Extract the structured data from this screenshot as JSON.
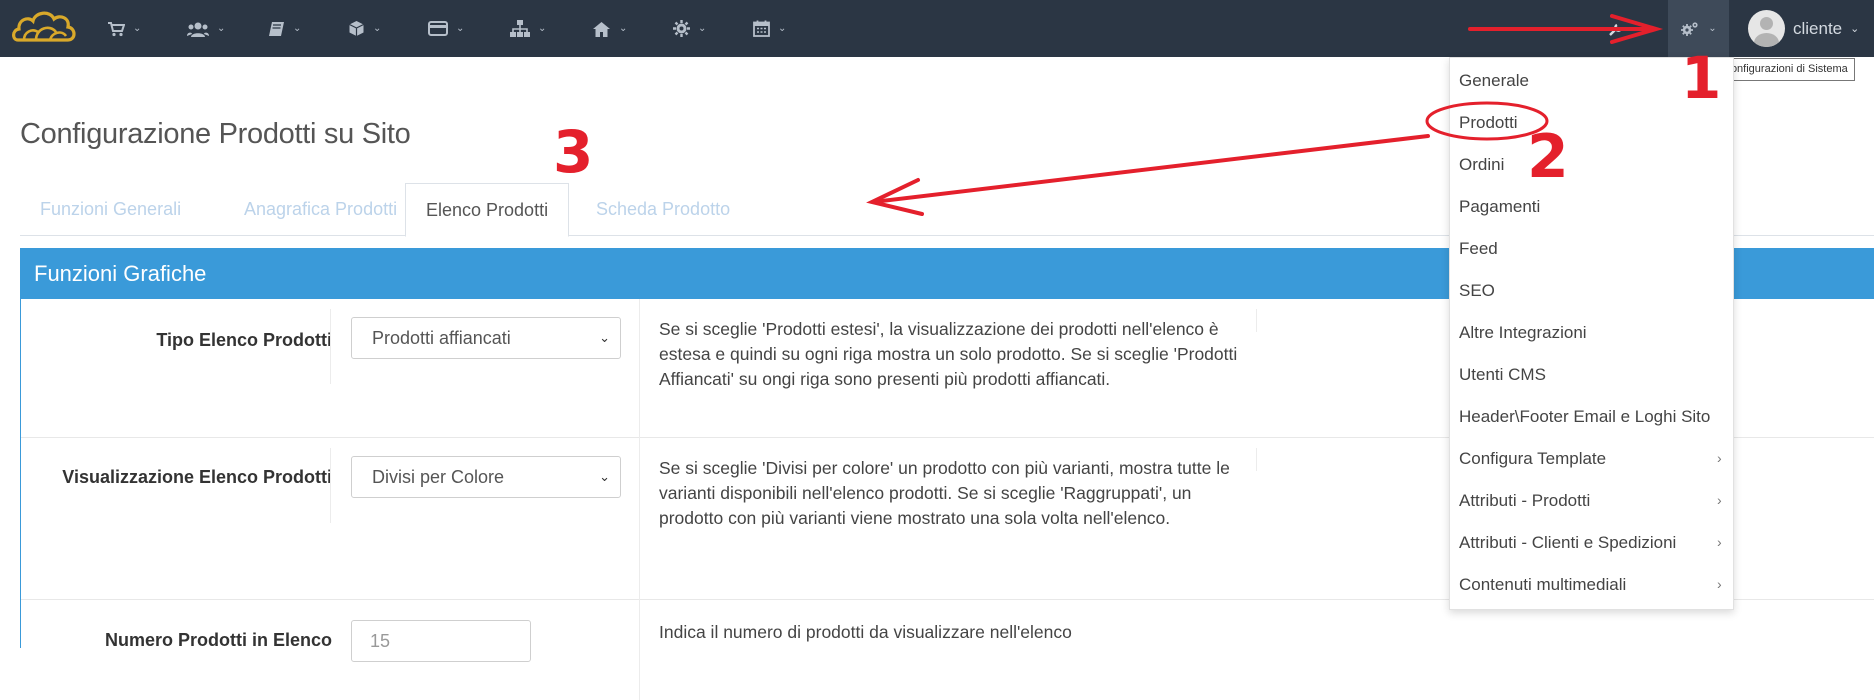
{
  "navbar": {
    "items": [
      {
        "icon": "cart-icon"
      },
      {
        "icon": "users-icon"
      },
      {
        "icon": "book-icon"
      },
      {
        "icon": "box-icon"
      },
      {
        "icon": "credit-card-icon"
      },
      {
        "icon": "sitemap-icon"
      },
      {
        "icon": "home-icon"
      },
      {
        "icon": "gear-icon"
      },
      {
        "icon": "calendar-icon"
      }
    ],
    "system_config_icon": "cogs-icon",
    "user_name": "cliente",
    "tooltip": "Configurazioni di Sistema"
  },
  "page": {
    "title": "Configurazione Prodotti su Sito"
  },
  "tabs": [
    "Funzioni Generali",
    "Anagrafica Prodotti",
    "Elenco Prodotti",
    "Scheda Prodotto"
  ],
  "panel": {
    "title": "Funzioni Grafiche",
    "rows": [
      {
        "label": "Tipo Elenco Prodotti",
        "value": "Prodotti affiancati",
        "description": "Se si sceglie 'Prodotti estesi', la visualizzazione dei prodotti nell'elenco è estesa e quindi su ogni riga mostra un solo prodotto. Se si sceglie 'Prodotti Affiancati' su ongi riga sono presenti più prodotti affiancati."
      },
      {
        "label": "Visualizzazione Elenco Prodotti",
        "value": "Divisi per Colore",
        "description": "Se si sceglie 'Divisi per colore' un prodotto con più varianti, mostra tutte le varianti disponibili nell'elenco prodotti. Se si sceglie 'Raggruppati', un prodotto con più varianti viene mostrato una sola volta nell'elenco."
      },
      {
        "label": "Numero Prodotti in Elenco",
        "value": "15",
        "description": "Indica il numero di prodotti da visualizzare nell'elenco"
      }
    ]
  },
  "dropdown": {
    "items": [
      {
        "label": "Generale",
        "submenu": false
      },
      {
        "label": "Prodotti",
        "submenu": false
      },
      {
        "label": "Ordini",
        "submenu": false
      },
      {
        "label": "Pagamenti",
        "submenu": false
      },
      {
        "label": "Feed",
        "submenu": false
      },
      {
        "label": "SEO",
        "submenu": false
      },
      {
        "label": "Altre Integrazioni",
        "submenu": false
      },
      {
        "label": "Utenti CMS",
        "submenu": false
      },
      {
        "label": "Header\\Footer Email e Loghi Sito",
        "submenu": false
      },
      {
        "label": "Configura Template",
        "submenu": true
      },
      {
        "label": "Attributi - Prodotti",
        "submenu": true
      },
      {
        "label": "Attributi - Clienti e Spedizioni",
        "submenu": true
      },
      {
        "label": "Contenuti multimediali",
        "submenu": true
      }
    ]
  },
  "annotations": {
    "numbers": [
      "1",
      "2",
      "3"
    ],
    "color": "#e4202c"
  },
  "colors": {
    "navbar": "#2b3644",
    "panel_header": "#3a9ad9",
    "annotation": "#e4202c"
  }
}
